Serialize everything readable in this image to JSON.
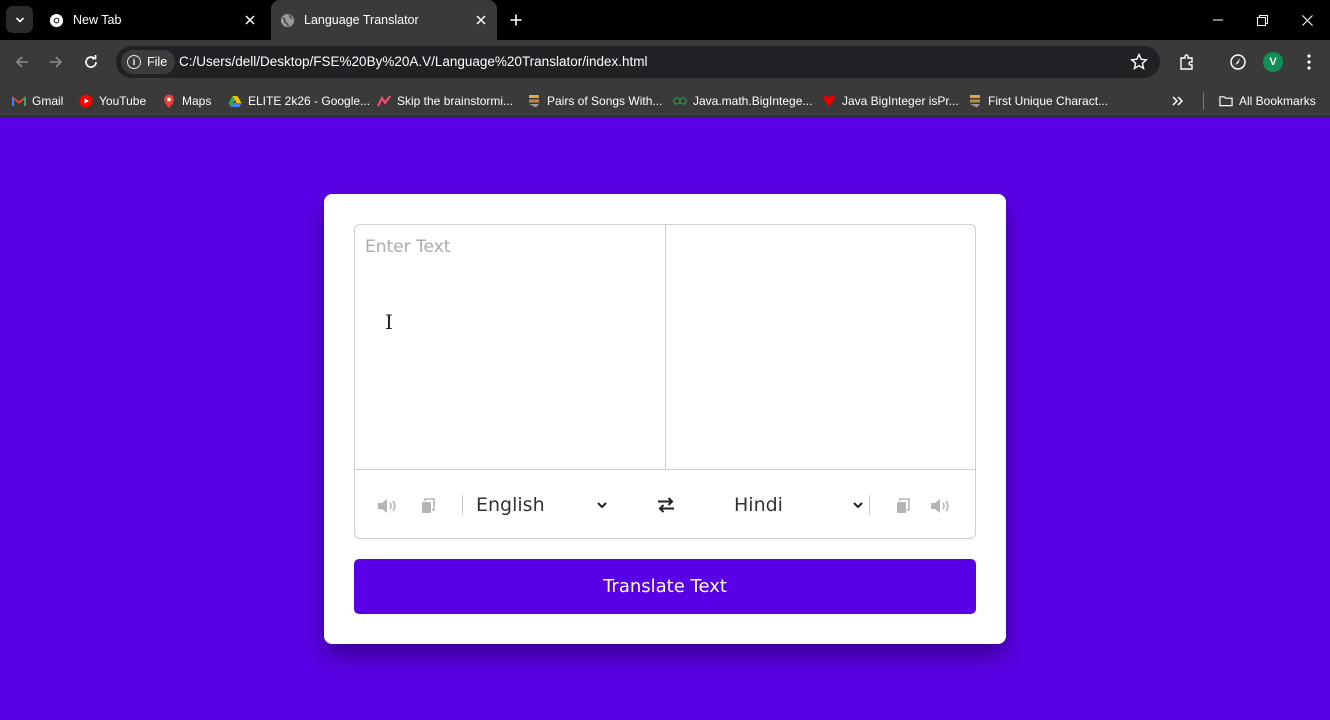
{
  "browser": {
    "tabs": [
      {
        "title": "New Tab",
        "icon": "chrome-icon"
      },
      {
        "title": "Language Translator",
        "icon": "globe-icon",
        "active": true
      }
    ],
    "address": {
      "chip_label": "File",
      "url": "C:/Users/dell/Desktop/FSE%20By%20A.V/Language%20Translator/index.html"
    },
    "profile_initial": "V",
    "bookmarks": [
      {
        "label": "Gmail",
        "icon": "gmail-icon"
      },
      {
        "label": "YouTube",
        "icon": "youtube-icon"
      },
      {
        "label": "Maps",
        "icon": "maps-icon"
      },
      {
        "label": "ELITE 2k26 - Google...",
        "icon": "google-drive-icon"
      },
      {
        "label": "Skip the brainstormi...",
        "icon": "brand-icon"
      },
      {
        "label": "Pairs of Songs With...",
        "icon": "stackexchange-icon"
      },
      {
        "label": "Java.math.BigIntege...",
        "icon": "gfg-icon"
      },
      {
        "label": "Java BigInteger isPr...",
        "icon": "heart-icon"
      },
      {
        "label": "First Unique Charact...",
        "icon": "stackexchange-icon"
      }
    ],
    "all_bookmarks_label": "All Bookmarks"
  },
  "translator": {
    "from_placeholder": "Enter Text",
    "to_text": "",
    "from_language": "English",
    "to_language": "Hindi",
    "button_label": "Translate Text"
  },
  "colors": {
    "accent": "#5a00e6",
    "chrome_dark": "#000000",
    "toolbar": "#3a3a3a"
  }
}
